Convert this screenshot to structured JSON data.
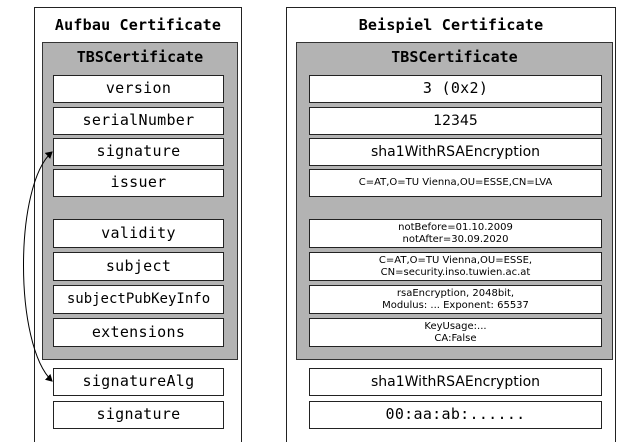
{
  "left_panel": {
    "title": "Aufbau Certificate",
    "tbs_title": "TBSCertificate",
    "fields": [
      "version",
      "serialNumber",
      "signature",
      "issuer",
      "validity",
      "subject",
      "subjectPubKeyInfo",
      "extensions"
    ],
    "outer_fields": [
      "signatureAlg",
      "signature"
    ]
  },
  "right_panel": {
    "title": "Beispiel Certificate",
    "tbs_title": "TBSCertificate",
    "values": [
      "3 (0x2)",
      "12345",
      "sha1WithRSAEncryption",
      "C=AT,O=TU Vienna,OU=ESSE,CN=LVA",
      "notBefore=01.10.2009\nnotAfter=30.09.2020",
      "C=AT,O=TU Vienna,OU=ESSE,\nCN=security.inso.tuwien.ac.at",
      "rsaEncryption, 2048bit,\nModulus: ... Exponent: 65537",
      "KeyUsage:...\nCA:False"
    ],
    "outer_values": [
      "sha1WithRSAEncryption",
      "00:aa:ab:......"
    ]
  }
}
